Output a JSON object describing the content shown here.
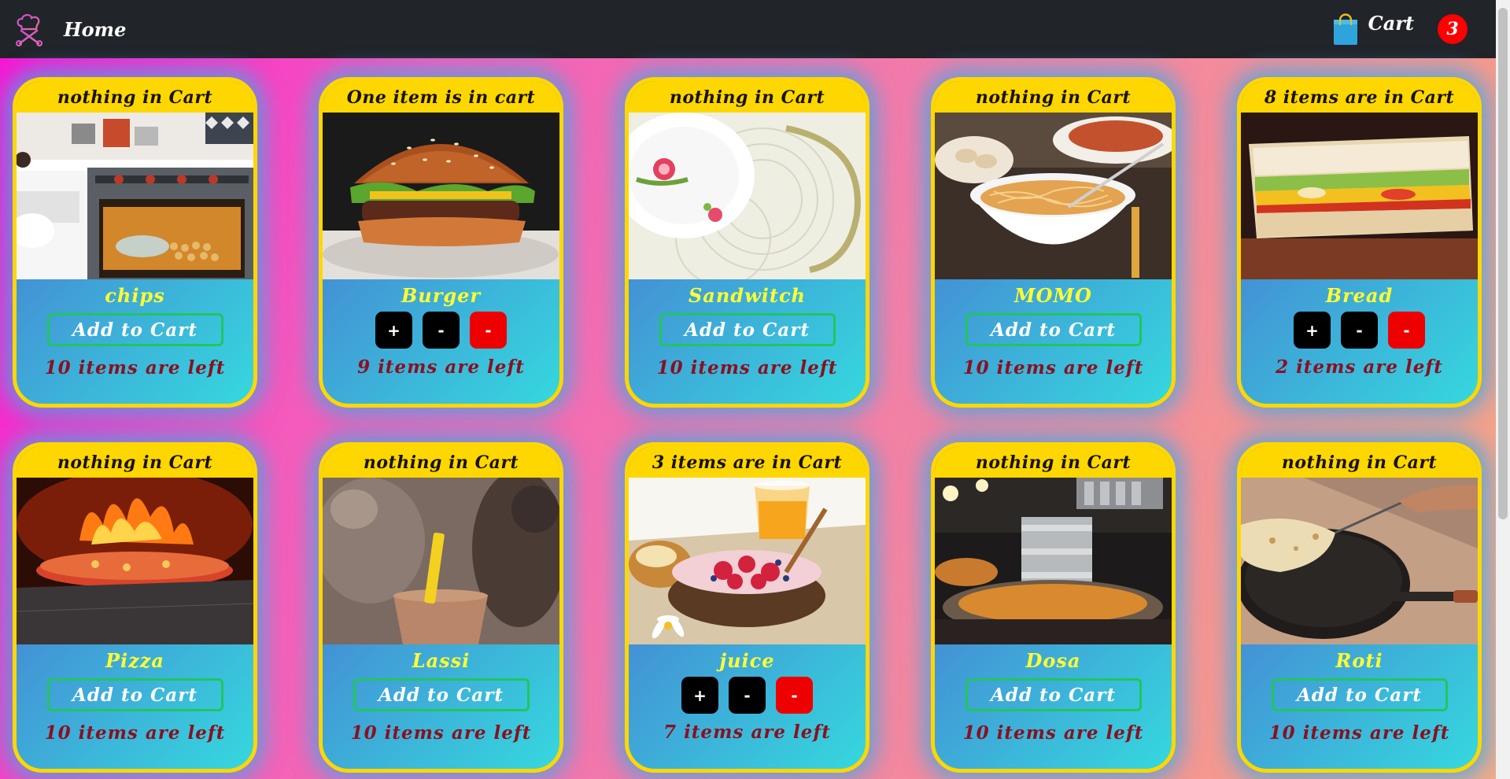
{
  "navbar": {
    "home_label": "Home",
    "cart_label": "Cart",
    "cart_count": "3"
  },
  "products": [
    {
      "header": "nothing in Cart",
      "name": "chips",
      "stock": "10 items are left",
      "in_cart": false,
      "image": "chips-oven-image"
    },
    {
      "header": "One item is in cart",
      "name": "Burger",
      "stock": "9 items are left",
      "in_cart": true,
      "image": "burger-image"
    },
    {
      "header": "nothing in Cart",
      "name": "Sandwitch",
      "stock": "10 items are left",
      "in_cart": false,
      "image": "sandwich-plate-image"
    },
    {
      "header": "nothing in Cart",
      "name": "MOMO",
      "stock": "10 items are left",
      "in_cart": false,
      "image": "momo-noodles-image"
    },
    {
      "header": "8 items are in Cart",
      "name": "Bread",
      "stock": "2 items are left",
      "in_cart": true,
      "image": "bread-sandwich-image"
    },
    {
      "header": "nothing in Cart",
      "name": "Pizza",
      "stock": "10 items are left",
      "in_cart": false,
      "image": "pizza-oven-image"
    },
    {
      "header": "nothing in Cart",
      "name": "Lassi",
      "stock": "10 items are left",
      "in_cart": false,
      "image": "lassi-cup-image"
    },
    {
      "header": "3 items are in Cart",
      "name": "juice",
      "stock": "7 items are left",
      "in_cart": true,
      "image": "juice-bowl-image"
    },
    {
      "header": "nothing in Cart",
      "name": "Dosa",
      "stock": "10 items are left",
      "in_cart": false,
      "image": "dosa-stall-image"
    },
    {
      "header": "nothing in Cart",
      "name": "Roti",
      "stock": "10 items are left",
      "in_cart": false,
      "image": "roti-pan-image"
    }
  ],
  "labels": {
    "add_to_cart": "Add to Cart",
    "plus": "+",
    "minus": "-"
  },
  "colors": {
    "navbar": "#212429",
    "card_header": "#ffd700",
    "item_name": "#ffff33",
    "stock_text": "#8a1020",
    "add_button_border": "#22c55e",
    "remove_button": "#ee0000",
    "badge": "#ff0000"
  }
}
